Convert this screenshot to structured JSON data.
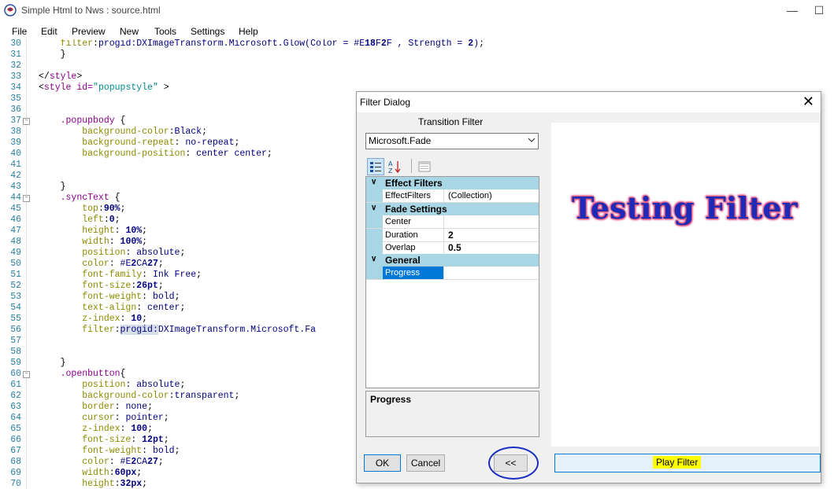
{
  "window": {
    "title": "Simple Html to Nws : source.html",
    "minimize": "—",
    "maximize": "☐"
  },
  "menu": [
    "File",
    "Edit",
    "Preview",
    "New",
    "Tools",
    "Settings",
    "Help"
  ],
  "code_lines": [
    {
      "n": "30",
      "text": "    filter:progid:DXImageTransform.Microsoft.Glow(Color = #E18F2F , Strength = 2);"
    },
    {
      "n": "31",
      "text": "    }"
    },
    {
      "n": "32",
      "text": ""
    },
    {
      "n": "33",
      "text": "</style>"
    },
    {
      "n": "34",
      "text": "<style id=\"popupstyle\" >"
    },
    {
      "n": "35",
      "text": ""
    },
    {
      "n": "36",
      "text": ""
    },
    {
      "n": "37",
      "text": "    .popupbody {"
    },
    {
      "n": "38",
      "text": "        background-color:Black;"
    },
    {
      "n": "39",
      "text": "        background-repeat: no-repeat;"
    },
    {
      "n": "40",
      "text": "        background-position: center center;"
    },
    {
      "n": "41",
      "text": ""
    },
    {
      "n": "42",
      "text": ""
    },
    {
      "n": "43",
      "text": "    }"
    },
    {
      "n": "44",
      "text": "    .syncText {"
    },
    {
      "n": "45",
      "text": "        top:90%;"
    },
    {
      "n": "46",
      "text": "        left:0;"
    },
    {
      "n": "47",
      "text": "        height: 10%;"
    },
    {
      "n": "48",
      "text": "        width: 100%;"
    },
    {
      "n": "49",
      "text": "        position: absolute;"
    },
    {
      "n": "50",
      "text": "        color: #E2CA27;"
    },
    {
      "n": "51",
      "text": "        font-family: Ink Free;"
    },
    {
      "n": "52",
      "text": "        font-size:26pt;"
    },
    {
      "n": "53",
      "text": "        font-weight: bold;"
    },
    {
      "n": "54",
      "text": "        text-align: center;"
    },
    {
      "n": "55",
      "text": "        z-index: 10;"
    },
    {
      "n": "56",
      "text": "        filter:progid:DXImageTransform.Microsoft.Fa"
    },
    {
      "n": "57",
      "text": ""
    },
    {
      "n": "58",
      "text": ""
    },
    {
      "n": "59",
      "text": "    }"
    },
    {
      "n": "60",
      "text": "    .openbutton{"
    },
    {
      "n": "61",
      "text": "        position: absolute;"
    },
    {
      "n": "62",
      "text": "        background-color:transparent;"
    },
    {
      "n": "63",
      "text": "        border: none;"
    },
    {
      "n": "64",
      "text": "        cursor: pointer;"
    },
    {
      "n": "65",
      "text": "        z-index: 100;"
    },
    {
      "n": "66",
      "text": "        font-size: 12pt;"
    },
    {
      "n": "67",
      "text": "        font-weight: bold;"
    },
    {
      "n": "68",
      "text": "        color: #E2CA27;"
    },
    {
      "n": "69",
      "text": "        width:60px;"
    },
    {
      "n": "70",
      "text": "        height:32px;"
    }
  ],
  "dialog": {
    "title": "Filter Dialog",
    "close": "✕",
    "transition_label": "Transition Filter",
    "transition_value": "Microsoft.Fade",
    "categories": [
      {
        "label": "Effect Filters",
        "toggle": "∨"
      },
      {
        "label": "Fade Settings",
        "toggle": "∨"
      },
      {
        "label": "General",
        "toggle": "∨"
      }
    ],
    "props": [
      {
        "name": "EffectFilters",
        "value": "(Collection)"
      },
      {
        "name": "Center",
        "value": ""
      },
      {
        "name": "Duration",
        "value": "2"
      },
      {
        "name": "Overlap",
        "value": "0.5"
      },
      {
        "name": "Progress",
        "value": ""
      }
    ],
    "description_title": "Progress",
    "ok": "OK",
    "cancel": "Cancel",
    "collapse": "<<",
    "preview_text": "Testing Filter",
    "play": "Play Filter"
  }
}
